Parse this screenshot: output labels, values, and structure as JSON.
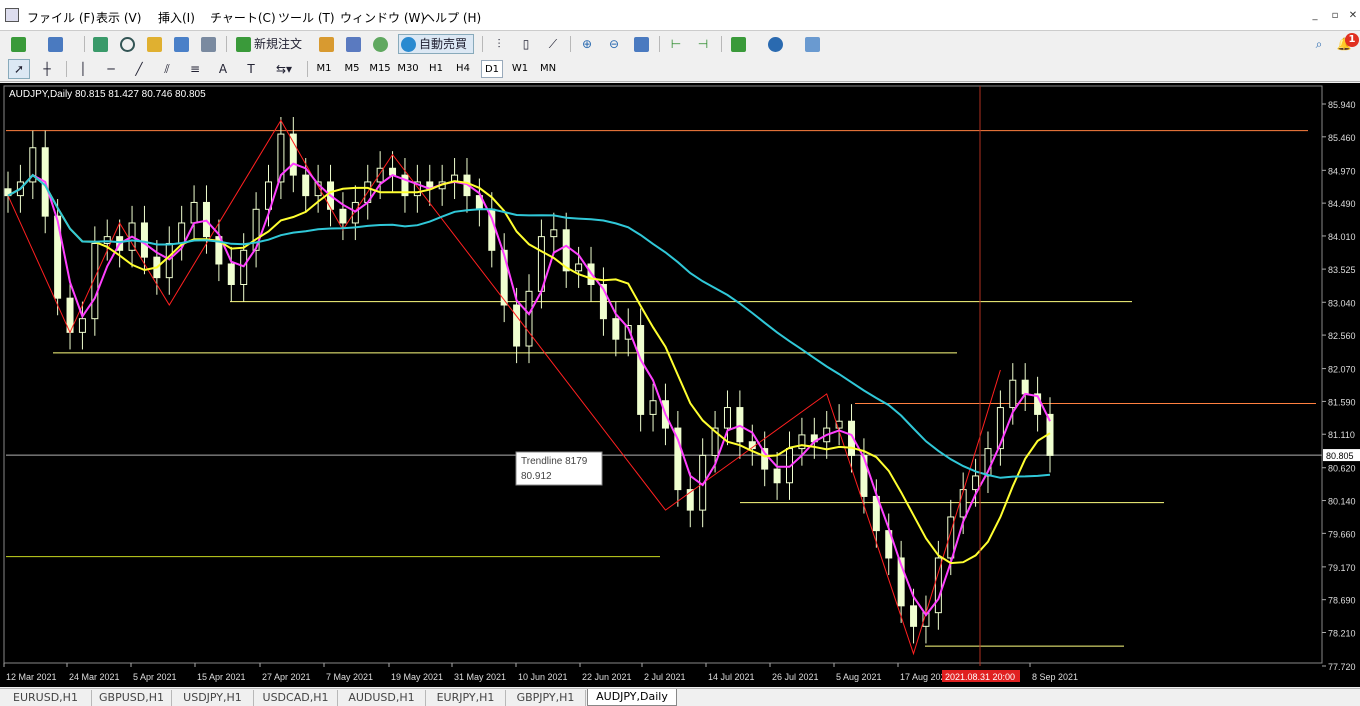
{
  "menu": {
    "items": [
      "ファイル (F)",
      "表示 (V)",
      "挿入(I)",
      "チャート(C)",
      "ツール (T)",
      "ウィンドウ (W)",
      "ヘルプ (H)"
    ]
  },
  "toolbar": {
    "new_order_label": "新規注文",
    "auto_trading_label": "自動売買",
    "notification_count": "1"
  },
  "timeframes": [
    "M1",
    "M5",
    "M15",
    "M30",
    "H1",
    "H4",
    "D1",
    "W1",
    "MN"
  ],
  "active_timeframe": "D1",
  "chart": {
    "header": "AUDJPY,Daily  80.815 81.427 80.746 80.805",
    "current_price_label": "80.805",
    "tooltip_line1": "Trendline 8179",
    "tooltip_line2": "80.912",
    "crosshair_time_label": "2021.08.31 20:00",
    "colors": {
      "background": "#000000",
      "bull_candle": "#f0ffd0",
      "bear_candle": "#f0ffd0",
      "ma_short": "#ff40ff",
      "ma_mid": "#ffff30",
      "ma_long": "#30c8d8",
      "zigzag": "#ff2020",
      "hline": "#ffff80",
      "orange_line": "#ff8040",
      "crosshair_time_bg": "#e02020"
    }
  },
  "chart_data": {
    "type": "candlestick",
    "symbol": "AUDJPY",
    "timeframe": "Daily",
    "ohlc_last": {
      "open": 80.815,
      "high": 81.427,
      "low": 80.746,
      "close": 80.805
    },
    "y_ticks": [
      "85.940",
      "85.460",
      "84.970",
      "84.490",
      "84.010",
      "83.525",
      "83.040",
      "82.560",
      "82.070",
      "81.590",
      "81.110",
      "80.620",
      "80.140",
      "79.660",
      "79.170",
      "78.690",
      "78.210",
      "77.720"
    ],
    "x_ticks": [
      "12 Mar 2021",
      "24 Mar 2021",
      "5 Apr 2021",
      "15 Apr 2021",
      "27 Apr 2021",
      "7 May 2021",
      "19 May 2021",
      "31 May 2021",
      "10 Jun 2021",
      "22 Jun 2021",
      "2 Jul 2021",
      "14 Jul 2021",
      "26 Jul 2021",
      "5 Aug 2021",
      "17 Aug 2021",
      "8 Sep 2021"
    ],
    "ylim": [
      77.72,
      86.2
    ],
    "series": [
      {
        "name": "close",
        "values": [
          84.6,
          84.8,
          85.3,
          84.3,
          83.1,
          82.6,
          82.8,
          83.9,
          84.0,
          83.8,
          84.2,
          83.7,
          83.4,
          83.9,
          84.2,
          84.5,
          84.0,
          83.6,
          83.3,
          83.8,
          84.4,
          84.8,
          85.5,
          84.9,
          84.6,
          84.8,
          84.4,
          84.2,
          84.5,
          84.8,
          85.0,
          84.9,
          84.6,
          84.8,
          84.7,
          84.8,
          84.9,
          84.6,
          84.4,
          83.8,
          83.0,
          82.4,
          83.2,
          84.0,
          84.1,
          83.5,
          83.6,
          83.3,
          82.8,
          82.5,
          82.7,
          81.4,
          81.6,
          81.2,
          80.3,
          80.0,
          80.8,
          81.2,
          81.5,
          81.0,
          80.9,
          80.6,
          80.4,
          80.9,
          81.1,
          81.0,
          81.2,
          81.3,
          80.8,
          80.2,
          79.7,
          79.3,
          78.6,
          78.3,
          78.5,
          79.3,
          79.9,
          80.3,
          80.5,
          80.9,
          81.5,
          81.9,
          81.7,
          81.4,
          80.8
        ]
      }
    ],
    "horizontal_levels": [
      85.55,
      83.05,
      82.3,
      80.11,
      79.32,
      78.01,
      81.56,
      80.805
    ],
    "trendline_value": 80.912
  },
  "tabs": [
    "EURUSD,H1",
    "GBPUSD,H1",
    "USDJPY,H1",
    "USDCAD,H1",
    "AUDUSD,H1",
    "EURJPY,H1",
    "GBPJPY,H1",
    "AUDJPY,Daily"
  ],
  "active_tab": "AUDJPY,Daily"
}
